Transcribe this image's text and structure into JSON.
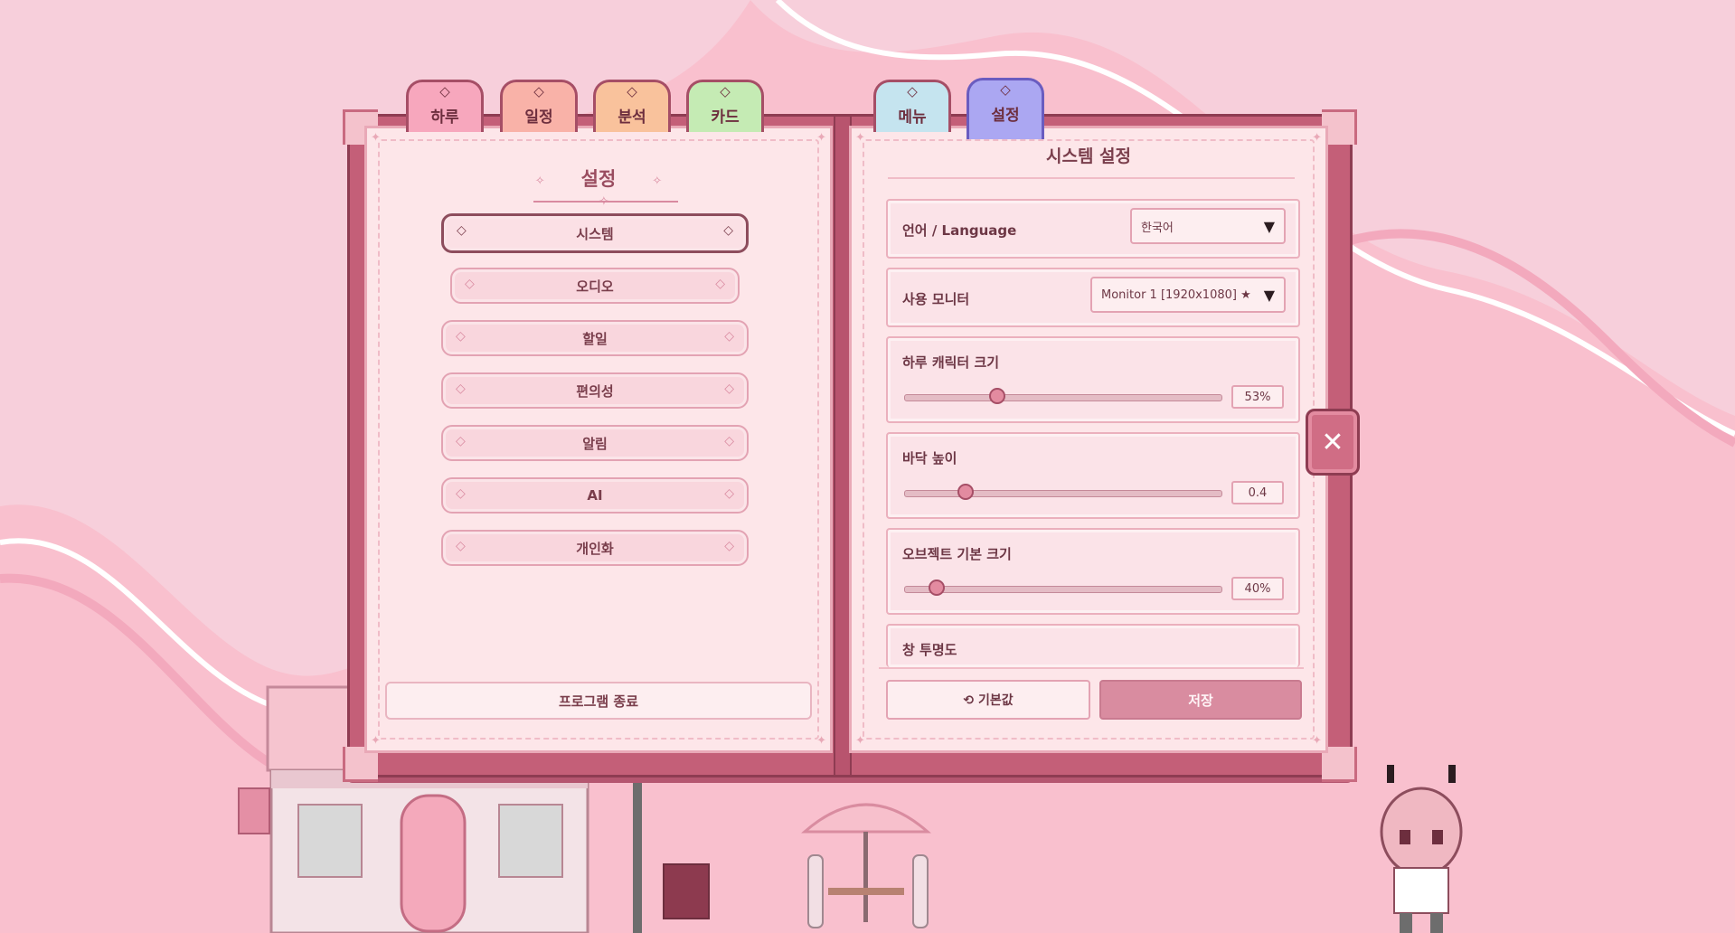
{
  "tabs": [
    {
      "label": "하루",
      "icon": "diamond-icon",
      "color": "#f7a7bd"
    },
    {
      "label": "일정",
      "icon": "diamond-icon",
      "color": "#f9b2a8"
    },
    {
      "label": "분석",
      "icon": "diamond-icon",
      "color": "#f9c29c"
    },
    {
      "label": "카드",
      "icon": "diamond-icon",
      "color": "#c5ebb4"
    },
    {
      "label": "메뉴",
      "icon": "diamond-icon",
      "color": "#c5e4ef"
    },
    {
      "label": "설정",
      "icon": "diamond-icon",
      "color": "#aba7f2",
      "active": true
    }
  ],
  "left_page": {
    "title": "설정",
    "menu": [
      {
        "label": "시스템",
        "selected": true
      },
      {
        "label": "오디오"
      },
      {
        "label": "할일"
      },
      {
        "label": "편의성"
      },
      {
        "label": "알림"
      },
      {
        "label": "AI"
      },
      {
        "label": "개인화"
      }
    ],
    "quit_label": "프로그램 종료"
  },
  "right_page": {
    "title": "시스템 설정",
    "language": {
      "label": "언어 / Language",
      "value": "한국어"
    },
    "monitor": {
      "label": "사용 모니터",
      "value": "Monitor 1 [1920x1080] ★"
    },
    "character_size": {
      "label": "하루 캐릭터 크기",
      "value": "53%",
      "fraction": 0.29
    },
    "floor_height": {
      "label": "바닥 높이",
      "value": "0.4",
      "fraction": 0.19
    },
    "object_size": {
      "label": "오브젝트 기본 크기",
      "value": "40%",
      "fraction": 0.1
    },
    "window_opacity": {
      "label": "창 투명도"
    },
    "reset_label": "⟲ 기본값",
    "save_label": "저장"
  },
  "colors": {
    "book": "#c45f78",
    "page": "#fde6e9",
    "accent": "#d98ca0",
    "background": "#f7cfdb"
  },
  "close_icon": "close-icon"
}
